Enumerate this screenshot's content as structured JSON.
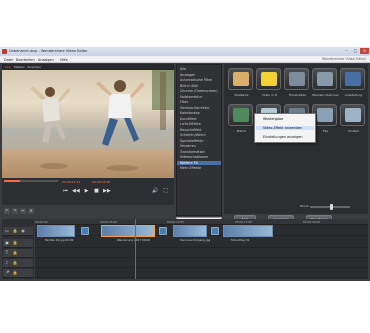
{
  "window": {
    "title": "Unbenannt.wvp - Wondershare Video Editor"
  },
  "menu": [
    "Datei",
    "Bearbeiten",
    "Anzeigen",
    "Hilfe"
  ],
  "brand": "Wondershare Video Editor",
  "preview": {
    "tabs": [
      "Clip",
      "Medien",
      "Vorschau"
    ],
    "timecode_current": "00:00:01:21",
    "timecode_total": "00:00:04:20",
    "progress": 0.3
  },
  "categories": {
    "items": [
      "Alle",
      "Anzeigen",
      "Automatische Filter",
      "Bild-in-Bild",
      "Chroma (Greenscreen)",
      "Farbkorrektur",
      "Filter",
      "Gamma-Korrektur",
      "Kaleidoskop",
      "Kunstfilter",
      "Licht-Effekte",
      "Rauscheffekt",
      "Schärfen/Weich",
      "Spezialeffekte",
      "Verzerren",
      "Transformation",
      "Videoschablonen",
      "Weitere FX",
      "Mehr Effekte"
    ],
    "selected_index": 17,
    "search_placeholder": "Effekte suchen"
  },
  "effects": [
    {
      "label": "Postkarte",
      "color": "#d8b06a"
    },
    {
      "label": "Video in Q",
      "color": "#f2d234"
    },
    {
      "label": "Filmstreifen",
      "color": "#7c8c9c"
    },
    {
      "label": "Wandern Rahmen",
      "color": "#8899aa"
    },
    {
      "label": "Ausstellung",
      "color": "#4a6fa5"
    },
    {
      "label": "Matrix",
      "color": "#4f8a5c"
    },
    {
      "label": "Tanz",
      "color": "#b4ccd8"
    },
    {
      "label": "Mosaik",
      "color": "#6b7d8f"
    },
    {
      "label": "Flip",
      "color": "#8aa2b5"
    },
    {
      "label": "Kristall",
      "color": "#9fb3c8"
    }
  ],
  "context_menu": {
    "items": [
      "Wiedergabe",
      "Video-Effekt anwenden",
      "Einstellungen anzeigen"
    ],
    "highlight_index": 1
  },
  "effect_buttons": [
    "Entf.",
    "Anwenden",
    "Hinzufügen"
  ],
  "nav": [
    {
      "label": "Schauspieler",
      "icon": "★"
    },
    {
      "label": "Medien",
      "icon": "▦"
    },
    {
      "label": "Effekte",
      "icon": "★"
    },
    {
      "label": "Übergänge",
      "icon": "⧉"
    },
    {
      "label": "Text",
      "icon": "T"
    },
    {
      "label": "Speichern",
      "icon": "⇩"
    }
  ],
  "nav_active_index": 2,
  "timeline": {
    "ruler": [
      "00:00:00",
      "00:00:05:00",
      "00:00:10:00",
      "00:00:15:00",
      "00:00:20:00"
    ],
    "zoom_label": "Zoom",
    "zoom_level": 0.55,
    "clips": [
      {
        "label": "Familie 01.jpg 00:00"
      },
      {
        "label": "Wanderung 2017 00:00"
      },
      {
        "label": "Sonnenuntergang.jpg"
      },
      {
        "label": "Strandtag 01"
      }
    ]
  }
}
